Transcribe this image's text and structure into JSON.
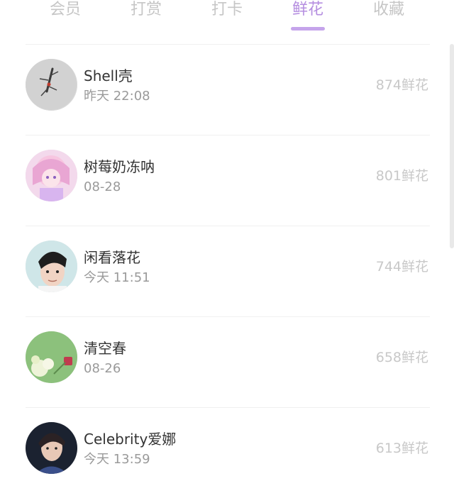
{
  "tabs": [
    {
      "label": "会员",
      "active": false
    },
    {
      "label": "打赏",
      "active": false
    },
    {
      "label": "打卡",
      "active": false
    },
    {
      "label": "鲜花",
      "active": true
    },
    {
      "label": "收藏",
      "active": false
    }
  ],
  "colors": {
    "active_tab": "#b58ee0",
    "inactive_tab": "#c6c6c6",
    "underline": "#c5a4eb",
    "name_text": "#333333",
    "time_text": "#9a9a9a",
    "count_text": "#c8c8c8"
  },
  "items": [
    {
      "name": "Shell壳",
      "time": "昨天 22:08",
      "flowers": "874鲜花",
      "avatar": "gray-insect-avatar"
    },
    {
      "name": "树莓奶冻呐",
      "time": "08-28",
      "flowers": "801鲜花",
      "avatar": "pink-anime-avatar"
    },
    {
      "name": "闲看落花",
      "time": "今天 11:51",
      "flowers": "744鲜花",
      "avatar": "boy-portrait-avatar"
    },
    {
      "name": "清空春",
      "time": "08-26",
      "flowers": "658鲜花",
      "avatar": "green-flower-avatar"
    },
    {
      "name": "Celebrity爱娜",
      "time": "今天 13:59",
      "flowers": "613鲜花",
      "avatar": "dark-portrait-avatar"
    }
  ]
}
